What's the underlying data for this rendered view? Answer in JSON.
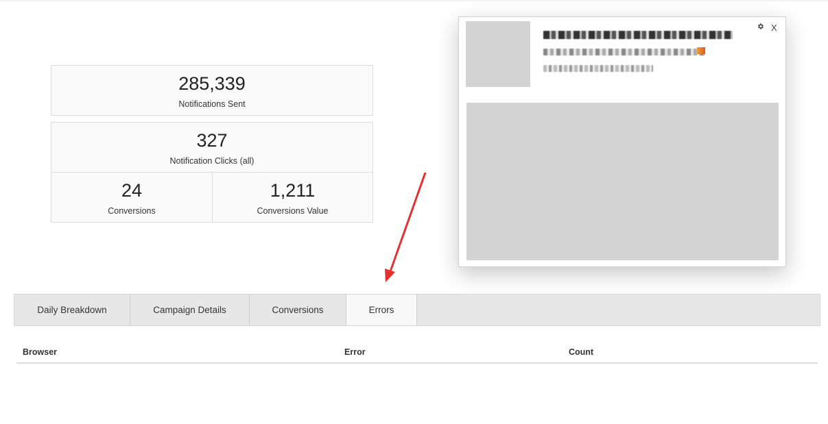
{
  "stats": {
    "notifications_sent": {
      "value": "285,339",
      "label": "Notifications Sent"
    },
    "notification_clicks": {
      "value": "327",
      "label": "Notification Clicks (all)"
    },
    "conversions": {
      "value": "24",
      "label": "Conversions"
    },
    "conversions_value": {
      "value": "1,211",
      "label": "Conversions Value"
    }
  },
  "preview": {
    "close_label": "X",
    "gear_icon": "gear-icon"
  },
  "tabs": [
    {
      "label": "Daily Breakdown",
      "active": false
    },
    {
      "label": "Campaign Details",
      "active": false
    },
    {
      "label": "Conversions",
      "active": false
    },
    {
      "label": "Errors",
      "active": true
    }
  ],
  "table": {
    "columns": [
      "Browser",
      "Error",
      "Count"
    ],
    "rows": []
  },
  "colors": {
    "annotation_arrow": "#e53030",
    "tab_active_bg": "#f8f8f8",
    "tab_bar_bg": "#e7e7e7"
  }
}
